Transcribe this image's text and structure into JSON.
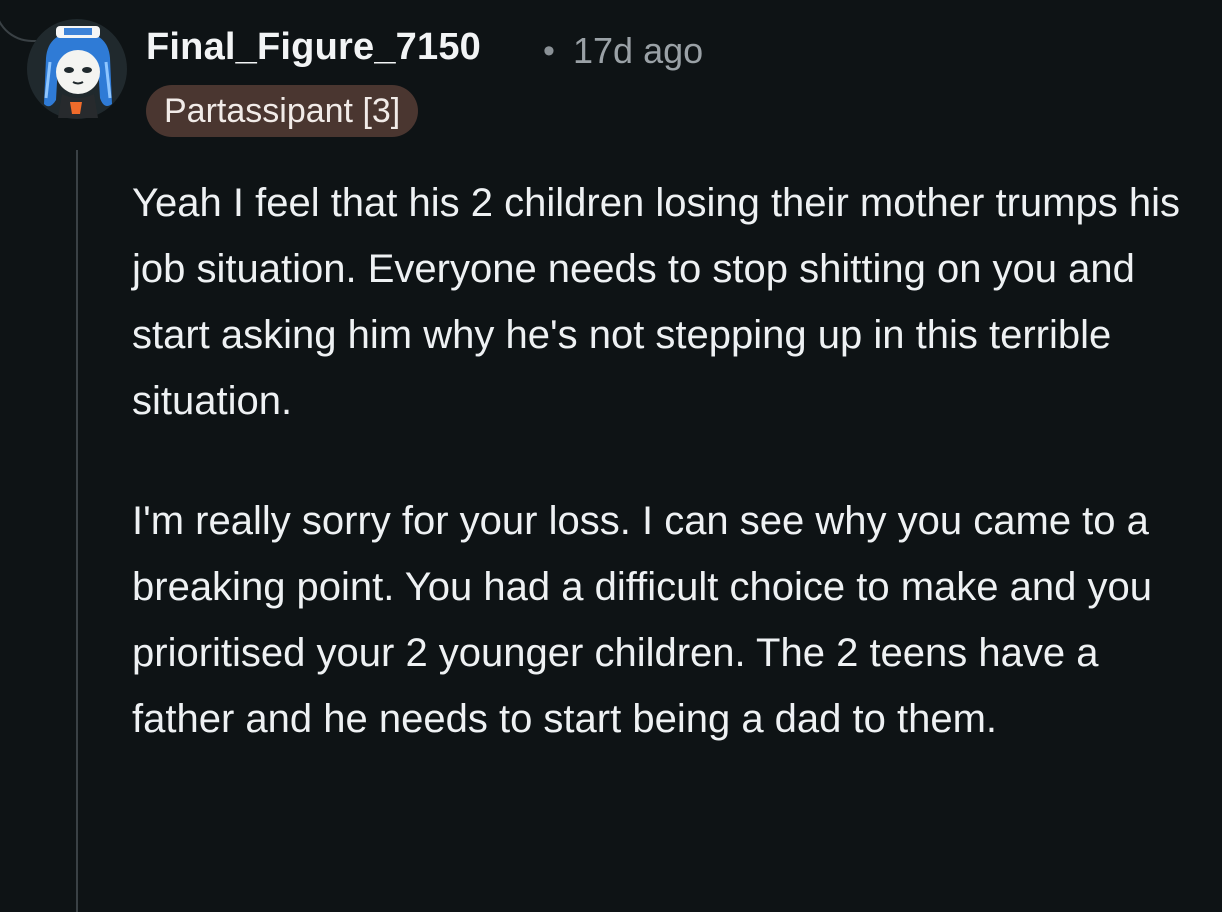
{
  "comment": {
    "author": "Final_Figure_7150",
    "separator": "•",
    "timestamp": "17d ago",
    "flair": "Partassipant [3]",
    "avatar_icon": "snoo-avatar-icon",
    "paragraphs": [
      "Yeah I feel that his 2 children losing their mother trumps his job situation. Everyone needs to stop shitting on you and start asking him why he's not stepping up in this terrible situation.",
      "I'm really sorry for your loss. I can see why you came to a breaking point. You had a difficult choice to make and you prioritised your 2 younger children. The 2 teens have a father and he needs to start being a dad to them."
    ]
  },
  "colors": {
    "background": "#0e1315",
    "text": "#eef1f3",
    "meta": "#9aa1a6",
    "flair_bg": "#4a3630",
    "thread_line": "#3a4145"
  }
}
